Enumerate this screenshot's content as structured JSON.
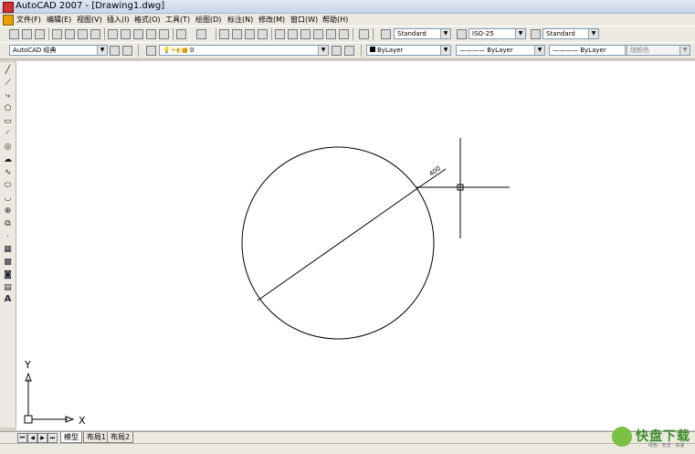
{
  "window": {
    "title": "AutoCAD 2007 - [Drawing1.dwg]"
  },
  "menu": [
    "文件(F)",
    "编辑(E)",
    "视图(V)",
    "插入(I)",
    "格式(O)",
    "工具(T)",
    "绘图(D)",
    "标注(N)",
    "修改(M)",
    "窗口(W)",
    "帮助(H)"
  ],
  "toolbar_styles": {
    "text_style": "Standard",
    "dim_style": "ISO-25",
    "table_style": "Standard"
  },
  "toolbar_layers": {
    "workspace": "AutoCAD 经典",
    "layer": "0",
    "color": "ByLayer",
    "linetype": "ByLayer",
    "lineweight": "ByLayer",
    "plot_style": "随颜色"
  },
  "draw_tools": [
    "line-icon",
    "construction-line-icon",
    "polyline-icon",
    "polygon-icon",
    "rectangle-icon",
    "arc-icon",
    "circle-icon",
    "revision-cloud-icon",
    "spline-icon",
    "ellipse-icon",
    "ellipse-arc-icon",
    "insert-block-icon",
    "make-block-icon",
    "point-icon",
    "hatch-icon",
    "gradient-icon",
    "region-icon",
    "table-icon",
    "multiline-text-icon"
  ],
  "drawing": {
    "dimension_text": "400",
    "ucs_x_label": "X",
    "ucs_y_label": "Y"
  },
  "layout_tabs": [
    "模型",
    "布局1",
    "布局2"
  ],
  "watermark": {
    "brand": "快盘下载",
    "tagline": "绿色 · 安全 · 高速"
  }
}
